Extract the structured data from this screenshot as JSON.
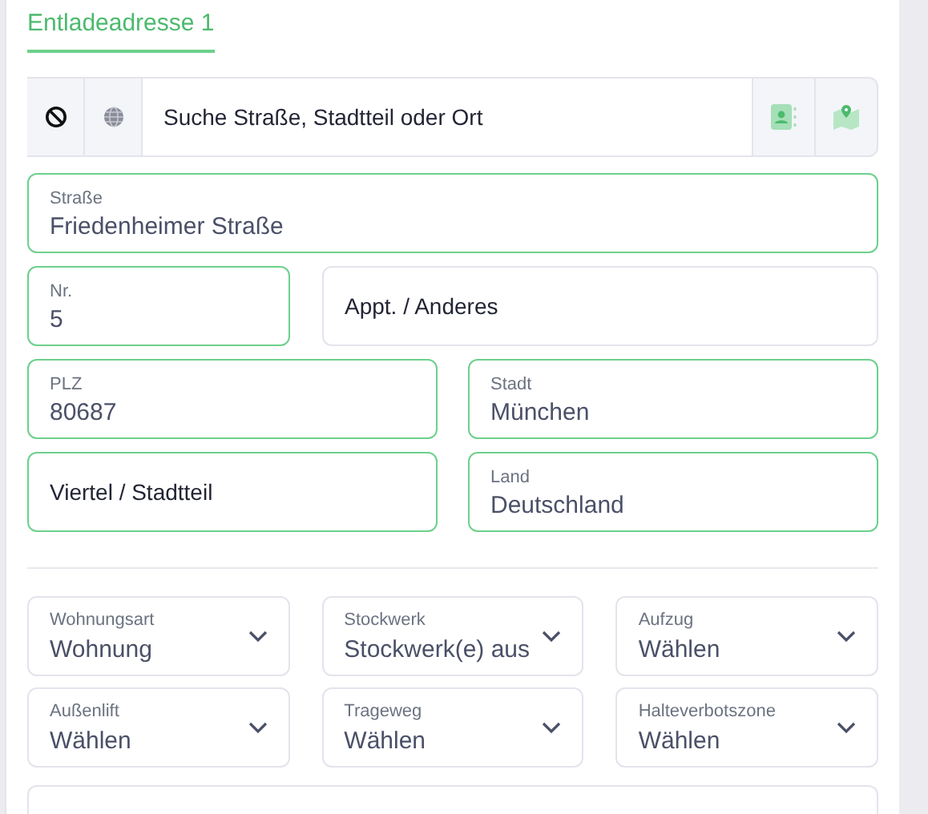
{
  "tabs": [
    {
      "label": "Entladeadresse 1",
      "selected": true
    }
  ],
  "search": {
    "placeholder": "Suche Straße, Stadtteil oder Ort"
  },
  "fields": [
    {
      "label": "Straße",
      "value": "Friedenheimer Straße",
      "highlighted": true
    },
    {
      "label": "Nr.",
      "value": "5",
      "highlighted": true
    },
    {
      "placeholder": "Appt. / Anderes",
      "highlighted": false
    },
    {
      "label": "PLZ",
      "value": "80687",
      "highlighted": true
    },
    {
      "label": "Stadt",
      "value": "München",
      "highlighted": true
    },
    {
      "placeholder": "Viertel / Stadtteil",
      "highlighted": true
    },
    {
      "label": "Land",
      "value": "Deutschland",
      "highlighted": true
    }
  ],
  "selects": [
    {
      "label": "Wohnungsart",
      "value": "Wohnung"
    },
    {
      "label": "Stockwerk",
      "value": "Stockwerk(e) aus"
    },
    {
      "label": "Aufzug",
      "value": "Wählen"
    },
    {
      "label": "Außenlift",
      "value": "Wählen"
    },
    {
      "label": "Trageweg",
      "value": "Wählen"
    },
    {
      "label": "Halteverbotszone",
      "value": "Wählen"
    }
  ]
}
